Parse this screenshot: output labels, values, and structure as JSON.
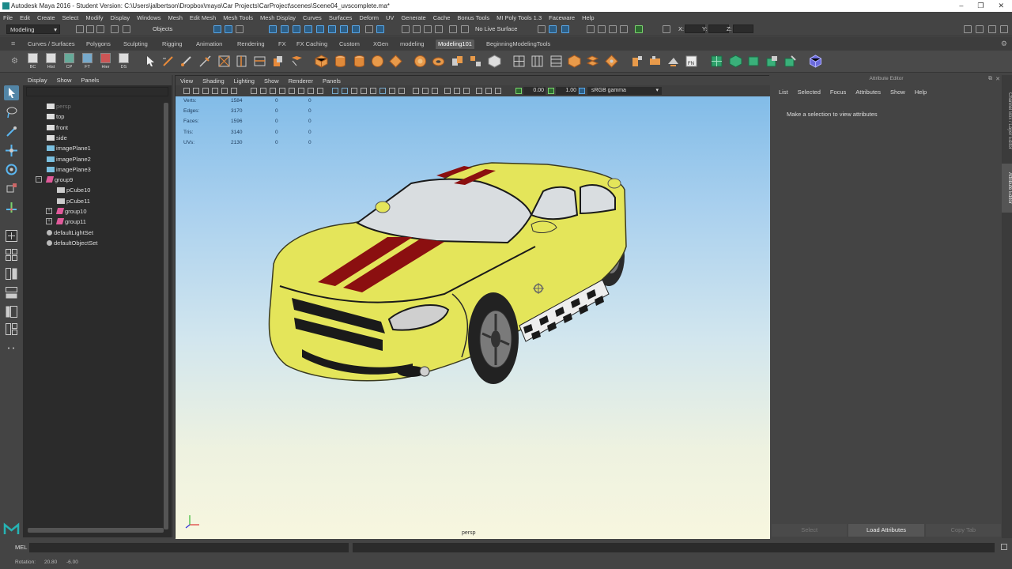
{
  "window": {
    "title": "Autodesk Maya 2016 - Student Version: C:\\Users\\jalbertson\\Dropbox\\maya\\Car Projects\\CarProject\\scenes\\Scene04_uvscomplete.ma*",
    "controls": [
      "–",
      "❐",
      "✕"
    ]
  },
  "menubar": [
    "File",
    "Edit",
    "Create",
    "Select",
    "Modify",
    "Display",
    "Windows",
    "Mesh",
    "Edit Mesh",
    "Mesh Tools",
    "Mesh Display",
    "Curves",
    "Surfaces",
    "Deform",
    "UV",
    "Generate",
    "Cache",
    "Bonus Tools",
    "MI Poly Tools 1.3",
    "Faceware",
    "Help"
  ],
  "statusline": {
    "mode": "Modeling",
    "selection_mode": "Objects",
    "live_surface": "No Live Surface",
    "axis_labels": [
      "X:",
      "Y:",
      "Z:"
    ]
  },
  "shelf_tabs": [
    {
      "label": "Curves / Surfaces",
      "active": false
    },
    {
      "label": "Polygons",
      "active": false
    },
    {
      "label": "Sculpting",
      "active": false
    },
    {
      "label": "Rigging",
      "active": false
    },
    {
      "label": "Animation",
      "active": false
    },
    {
      "label": "Rendering",
      "active": false
    },
    {
      "label": "FX",
      "active": false
    },
    {
      "label": "FX Caching",
      "active": false
    },
    {
      "label": "Custom",
      "active": false
    },
    {
      "label": "XGen",
      "active": false
    },
    {
      "label": "modeling",
      "active": false
    },
    {
      "label": "Modeling101",
      "active": true
    },
    {
      "label": "BeginningModelingTools",
      "active": false
    }
  ],
  "shelf_buttons": [
    "BC",
    "Hist",
    "CP",
    "FT",
    "Hier",
    "DS"
  ],
  "outliner": {
    "menu": [
      "Display",
      "Show",
      "Panels"
    ],
    "items": [
      {
        "label": "persp",
        "indent": 0,
        "icon": "camera-icon",
        "dim": true
      },
      {
        "label": "top",
        "indent": 0,
        "icon": "camera-icon",
        "dim": false
      },
      {
        "label": "front",
        "indent": 0,
        "icon": "camera-icon",
        "dim": false
      },
      {
        "label": "side",
        "indent": 0,
        "icon": "camera-icon",
        "dim": false
      },
      {
        "label": "imagePlane1",
        "indent": 0,
        "icon": "image-plane-icon",
        "dim": false
      },
      {
        "label": "imagePlane2",
        "indent": 0,
        "icon": "image-plane-icon",
        "dim": false
      },
      {
        "label": "imagePlane3",
        "indent": 0,
        "icon": "image-plane-icon",
        "dim": false
      },
      {
        "label": "group9",
        "indent": 0,
        "icon": "group-icon",
        "dim": false,
        "expander": "−"
      },
      {
        "label": "pCube10",
        "indent": 1,
        "icon": "mesh-icon",
        "dim": false
      },
      {
        "label": "pCube11",
        "indent": 1,
        "icon": "mesh-icon",
        "dim": false
      },
      {
        "label": "group10",
        "indent": 1,
        "icon": "group-icon",
        "dim": false,
        "expander": "+"
      },
      {
        "label": "group11",
        "indent": 1,
        "icon": "group-icon",
        "dim": false,
        "expander": "+"
      },
      {
        "label": "defaultLightSet",
        "indent": 0,
        "icon": "set-icon",
        "dim": false
      },
      {
        "label": "defaultObjectSet",
        "indent": 0,
        "icon": "set-icon",
        "dim": false
      }
    ]
  },
  "viewport": {
    "menu": [
      "View",
      "Shading",
      "Lighting",
      "Show",
      "Renderer",
      "Panels"
    ],
    "exposure": "0.00",
    "gamma": "1.00",
    "color_space": "sRGB gamma",
    "camera_label": "persp",
    "hud": [
      {
        "label": "Verts:",
        "v1": "1584",
        "v2": "0",
        "v3": "0"
      },
      {
        "label": "Edges:",
        "v1": "3170",
        "v2": "0",
        "v3": "0"
      },
      {
        "label": "Faces:",
        "v1": "1596",
        "v2": "0",
        "v3": "0"
      },
      {
        "label": "Tris:",
        "v1": "3140",
        "v2": "0",
        "v3": "0"
      },
      {
        "label": "UVs:",
        "v1": "2130",
        "v2": "0",
        "v3": "0"
      }
    ],
    "colors": {
      "car_body": "#e4e55a",
      "stripe": "#8b0f10",
      "window": "#d9dde0",
      "tire": "#2a2a2a"
    }
  },
  "attribute_editor": {
    "title": "Attribute Editor",
    "menu": [
      "List",
      "Selected",
      "Focus",
      "Attributes",
      "Show",
      "Help"
    ],
    "message": "Make a selection to view attributes",
    "buttons": [
      {
        "label": "Select",
        "active": false
      },
      {
        "label": "Load Attributes",
        "active": true
      },
      {
        "label": "Copy Tab",
        "active": false
      }
    ]
  },
  "side_tabs": [
    "Channel Box / Layer Editor",
    "Attribute Editor"
  ],
  "command_line": {
    "label": "MEL"
  },
  "help_line": {
    "label": "Rotation:",
    "v1": "20.80",
    "v2": "-6.00"
  }
}
